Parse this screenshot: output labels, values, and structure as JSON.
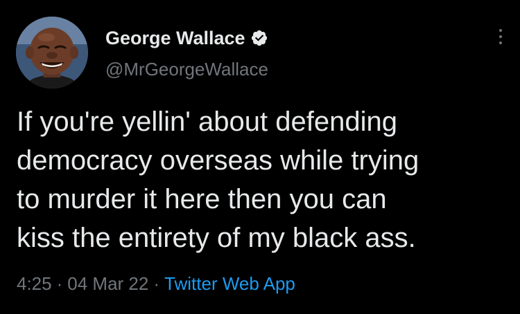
{
  "user": {
    "display_name": "George Wallace",
    "handle": "@MrGeorgeWallace",
    "verified_icon": "verified-badge-icon",
    "avatar_icon": "profile-photo"
  },
  "tweet": {
    "text_lines": [
      "If you're yellin' about defending",
      "democracy overseas while trying",
      "to murder it here then you can",
      "kiss the entirety of my black ass."
    ]
  },
  "meta": {
    "time": "4:25",
    "date": "04 Mar 22",
    "separator": "·",
    "source": "Twitter Web App"
  },
  "colors": {
    "background": "#000000",
    "text": "#e7e9ea",
    "secondary": "#71767b",
    "link": "#1d9bf0"
  }
}
